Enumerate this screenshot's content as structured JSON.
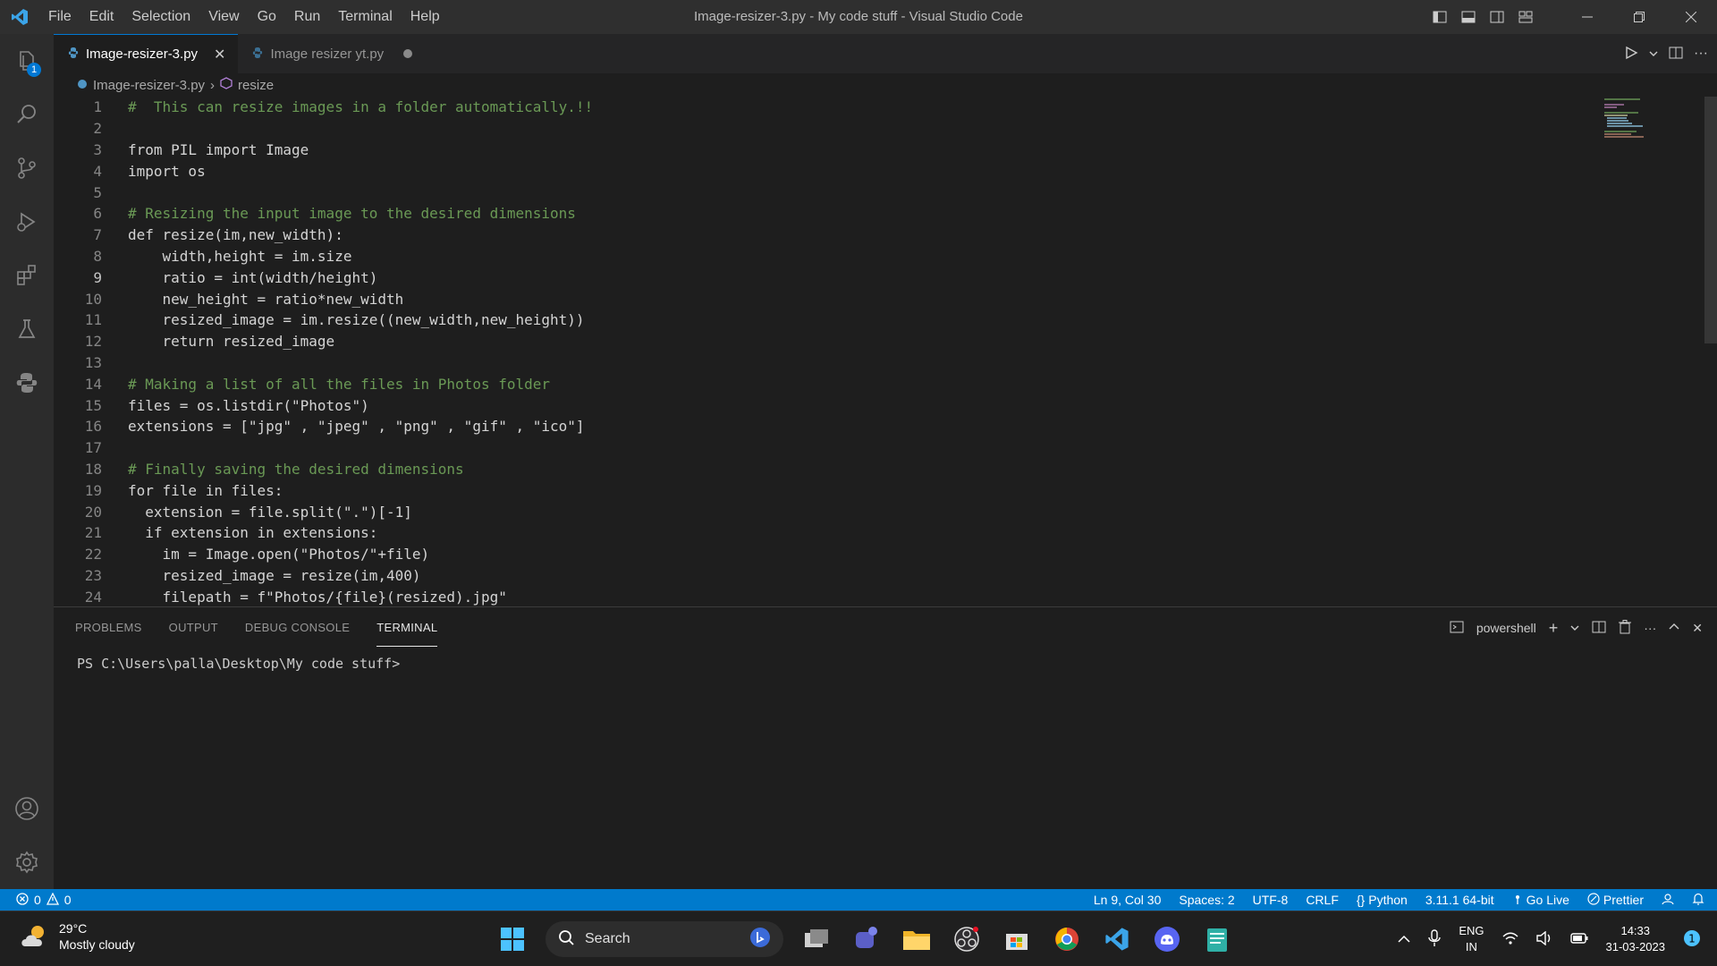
{
  "titlebar": {
    "menu": [
      "File",
      "Edit",
      "Selection",
      "View",
      "Go",
      "Run",
      "Terminal",
      "Help"
    ],
    "window_title": "Image-resizer-3.py - My code stuff - Visual Studio Code"
  },
  "activitybar": {
    "explorer_badge": "1"
  },
  "tabs": [
    {
      "label": "Image-resizer-3.py",
      "active": true
    },
    {
      "label": "Image resizer yt.py",
      "active": false
    }
  ],
  "breadcrumb": {
    "file": "Image-resizer-3.py",
    "symbol": "resize"
  },
  "editor": {
    "current_line": 9,
    "lines": [
      "#  This can resize images in a folder automatically.!!",
      "",
      "from PIL import Image",
      "import os",
      "",
      "# Resizing the input image to the desired dimensions",
      "def resize(im,new_width):",
      "    width,height = im.size",
      "    ratio = int(width/height)",
      "    new_height = ratio*new_width",
      "    resized_image = im.resize((new_width,new_height))",
      "    return resized_image",
      "",
      "# Making a list of all the files in Photos folder",
      "files = os.listdir(\"Photos\")",
      "extensions = [\"jpg\" , \"jpeg\" , \"png\" , \"gif\" , \"ico\"]",
      "",
      "# Finally saving the desired dimensions",
      "for file in files:",
      "  extension = file.split(\".\")[-1]",
      "  if extension in extensions:",
      "    im = Image.open(\"Photos/\"+file)",
      "    resized_image = resize(im,400)",
      "    filepath = f\"Photos/{file}(resized).jpg\""
    ]
  },
  "panel": {
    "tabs": [
      "PROBLEMS",
      "OUTPUT",
      "DEBUG CONSOLE",
      "TERMINAL"
    ],
    "active_tab": "TERMINAL",
    "shell": "powershell",
    "prompt": "PS C:\\Users\\palla\\Desktop\\My code stuff>"
  },
  "statusbar": {
    "errors": "0",
    "warnings": "0",
    "position": "Ln 9, Col 30",
    "spaces": "Spaces: 2",
    "encoding": "UTF-8",
    "eol": "CRLF",
    "language": "Python",
    "interpreter": "3.11.1 64-bit",
    "go_live": "Go Live",
    "prettier": "Prettier"
  },
  "taskbar": {
    "temperature": "29°C",
    "weather": "Mostly cloudy",
    "search_placeholder": "Search",
    "lang": "ENG",
    "region": "IN",
    "time": "14:33",
    "date": "31-03-2023"
  },
  "colors": {
    "accent": "#007acc",
    "titlebar": "#2f2f2f",
    "editor_bg": "#1e1e1e"
  }
}
